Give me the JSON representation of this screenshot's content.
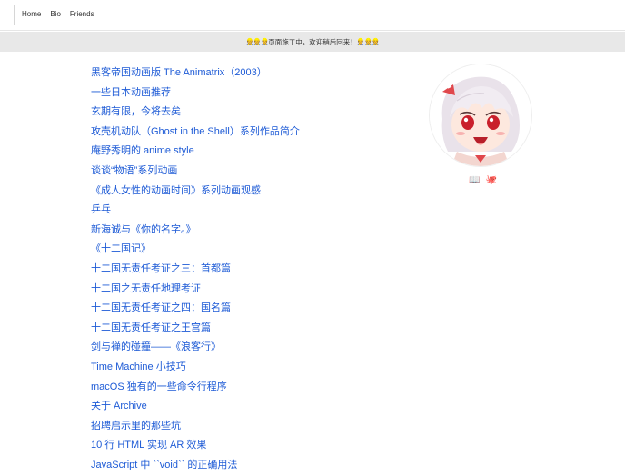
{
  "nav": {
    "links": [
      "Home",
      "Bio",
      "Friends"
    ]
  },
  "banner": {
    "workers_left": "👷👷👷",
    "text": "页面施工中，欢迎稍后回来！",
    "workers_right": "👷👷👷"
  },
  "posts": [
    "黑客帝国动画版 The Animatrix（2003）",
    "一些日本动画推荐",
    "玄期有限，今将去矣",
    "攻壳机动队（Ghost in the Shell）系列作品简介",
    "庵野秀明的 anime style",
    "谈谈“物语”系列动画",
    "《成人女性的动画时间》系列动画观感",
    "乒乓",
    "新海诚与《你的名字。》",
    "《十二国记》",
    "十二国无责任考证之三：首都篇",
    "十二国之无责任地理考证",
    "十二国无责任考证之四：国名篇",
    "十二国无责任考证之王宫篇",
    "剑与禅的碰撞——《浪客行》",
    "Time Machine 小技巧",
    "macOS 独有的一些命令行程序",
    "关于 Archive",
    "招聘启示里的那些坑",
    "10 行 HTML 实现 AR 效果",
    "JavaScript 中 ``void`` 的正确用法"
  ],
  "profile": {
    "icons": [
      {
        "glyph": "📖",
        "name": "book"
      },
      {
        "glyph": "🐙",
        "name": "octopus"
      }
    ]
  }
}
